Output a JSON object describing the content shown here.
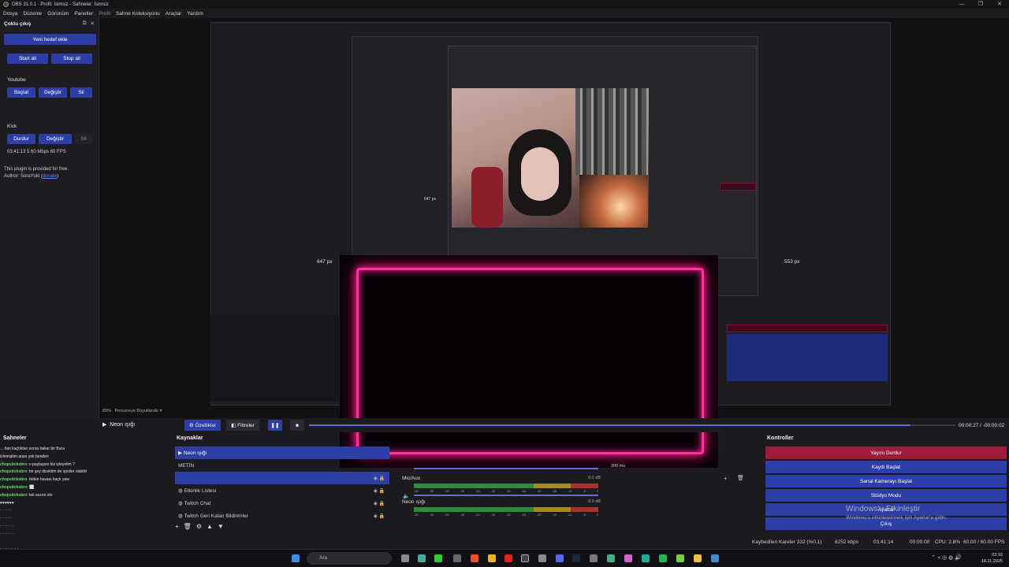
{
  "window": {
    "title": "OBS 31.0.1 - Profil: İsimsiz - Sahneler: İsimsiz",
    "controls": [
      "—",
      "❐",
      "✕"
    ]
  },
  "menu": [
    "Dosya",
    "Düzenle",
    "Görünüm",
    "Paneller",
    "Profil",
    "Sahne Koleksiyonu",
    "Araçlar",
    "Yardım"
  ],
  "multistream": {
    "title": "Çoklu çıkış",
    "add_target": "Yeni hedef ekle",
    "start_all": "Start all",
    "stop_all": "Stop all",
    "youtube": {
      "label": "Youtube",
      "start": "Başlat",
      "edit": "Değiştir",
      "delete": "Sil"
    },
    "kick": {
      "label": "Kick",
      "stop": "Durdur",
      "edit": "Değiştir",
      "delete": "Sil",
      "stats": "03:41:13  5.60 Mbps  60 FPS"
    },
    "info_line1": "This plugin is provided for free.",
    "info_author": "Author: SoraYuki (",
    "info_link": "donate",
    "info_end": ")"
  },
  "preview": {
    "px_label_1": "647 px",
    "px_label_2": "647 px",
    "px_label_3": "553 px"
  },
  "zoom": {
    "percent": "89%",
    "mode": "Pencereye Boyutlandır"
  },
  "toolbar": {
    "scene": "Neon ışığı",
    "properties": "Özellikler",
    "filters": "Filtreler",
    "timecode": "00:00:27 / -00:00:02",
    "seek_fraction": 0.93
  },
  "scenes": {
    "title": "Sahneler"
  },
  "chat": [
    {
      "user": "",
      "msg": "... dan kaçtıktan sonra bakar bir Bura"
    },
    {
      "user": "",
      "msg": "izlemiştim arası yok benden"
    },
    {
      "user": "chopsticksbro",
      "msg": ": o paylaşsın biz izleyelim ?"
    },
    {
      "user": "chopsticksbro",
      "msg": ": bir şey dicektim de spoiler olabilir"
    },
    {
      "user": "chopsticksbro",
      "msg": ": bütün havası kaçtı yaw"
    },
    {
      "user": "chopsticksbro",
      "msg": ": ⬜"
    },
    {
      "user": "chopsticksbro",
      "msg": ": tek sezon ztn"
    },
    {
      "user": "",
      "msg": "♥♥♥♥♥♥"
    },
    {
      "user": "",
      "msg": "· · · · ·"
    },
    {
      "user": "",
      "msg": "· · · · ·"
    },
    {
      "user": "",
      "msg": "· · · · · ·"
    },
    {
      "user": "",
      "msg": "· · · · · ·"
    },
    {
      "user": "",
      "msg": "■■■■■■"
    },
    {
      "user": "",
      "msg": "· · · · · · · ·"
    }
  ],
  "sources": {
    "title": "Kaynaklar",
    "items": [
      {
        "name": "Neon ışığı",
        "selected": true
      },
      {
        "name": "METİN",
        "selected": false
      },
      {
        "name": "",
        "selected": true
      },
      {
        "name": "Etkinlik Listesi",
        "selected": false
      },
      {
        "name": "Twitch Chat",
        "selected": false
      },
      {
        "name": "Twitch Geri Kalan Bildirimler",
        "selected": false
      }
    ],
    "buttons": [
      "+",
      "🗑",
      "⚙",
      "▲",
      "▼"
    ]
  },
  "audio": {
    "tracks": [
      {
        "name": "",
        "db": ""
      },
      {
        "name": "Mic/Aux",
        "db": "0.0 dB"
      },
      {
        "name": "Neon ışığı",
        "db": "0.0 dB"
      }
    ],
    "scale": [
      "-60",
      "-55",
      "-50",
      "-45",
      "-40",
      "-35",
      "-30",
      "-25",
      "-20",
      "-15",
      "-10",
      "-5",
      "0"
    ]
  },
  "transitions": {
    "duration": "300 ms"
  },
  "controls": {
    "title": "Kontroller",
    "stop_stream": "Yayını Durdur",
    "start_record": "Kaydı Başlat",
    "virtual_cam": "Sanal Kamerayı Başlat",
    "studio_mode": "Stüdyo Modu",
    "settings": "Ayarlar",
    "exit": "Çıkış"
  },
  "watermark": {
    "title": "Windows'u Etkinleştir",
    "subtitle": "Windows'u etkinleştirmek için Ayarlar'a gidin."
  },
  "status": {
    "dropped": "Kaybedilen Kareler 332 (%0.1)",
    "bitrate": "6252 kbps",
    "live": "03:41:14",
    "rec": "00:00:00",
    "cpu": "CPU: 2.8%",
    "fps": "60.00 / 60.00 FPS"
  },
  "taskbar": {
    "search": "Ara",
    "time": "03:16",
    "date": "18.11.2025"
  },
  "colors": {
    "accent": "#2d3fa6",
    "stop": "#a01a3c",
    "neon": "#ff2f9e",
    "chat_user": "#5fe06a"
  }
}
